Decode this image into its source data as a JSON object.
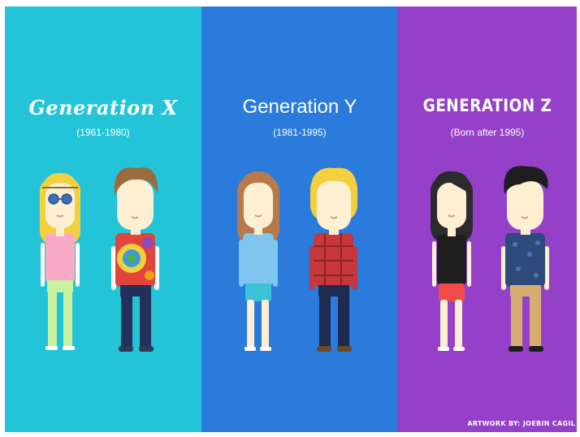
{
  "colors": {
    "gen_x_bg": "#23c4d8",
    "gen_y_bg": "#2a7bdc",
    "gen_z_bg": "#9440c8"
  },
  "generations": [
    {
      "title": "Generation X",
      "years": "(1961-1980)"
    },
    {
      "title": "Generation Y",
      "years": "(1981-1995)"
    },
    {
      "title": "GENERATION Z",
      "years": "(Born after 1995)"
    }
  ],
  "credit": "ARTWORK BY: JOEBIN CAGIL"
}
